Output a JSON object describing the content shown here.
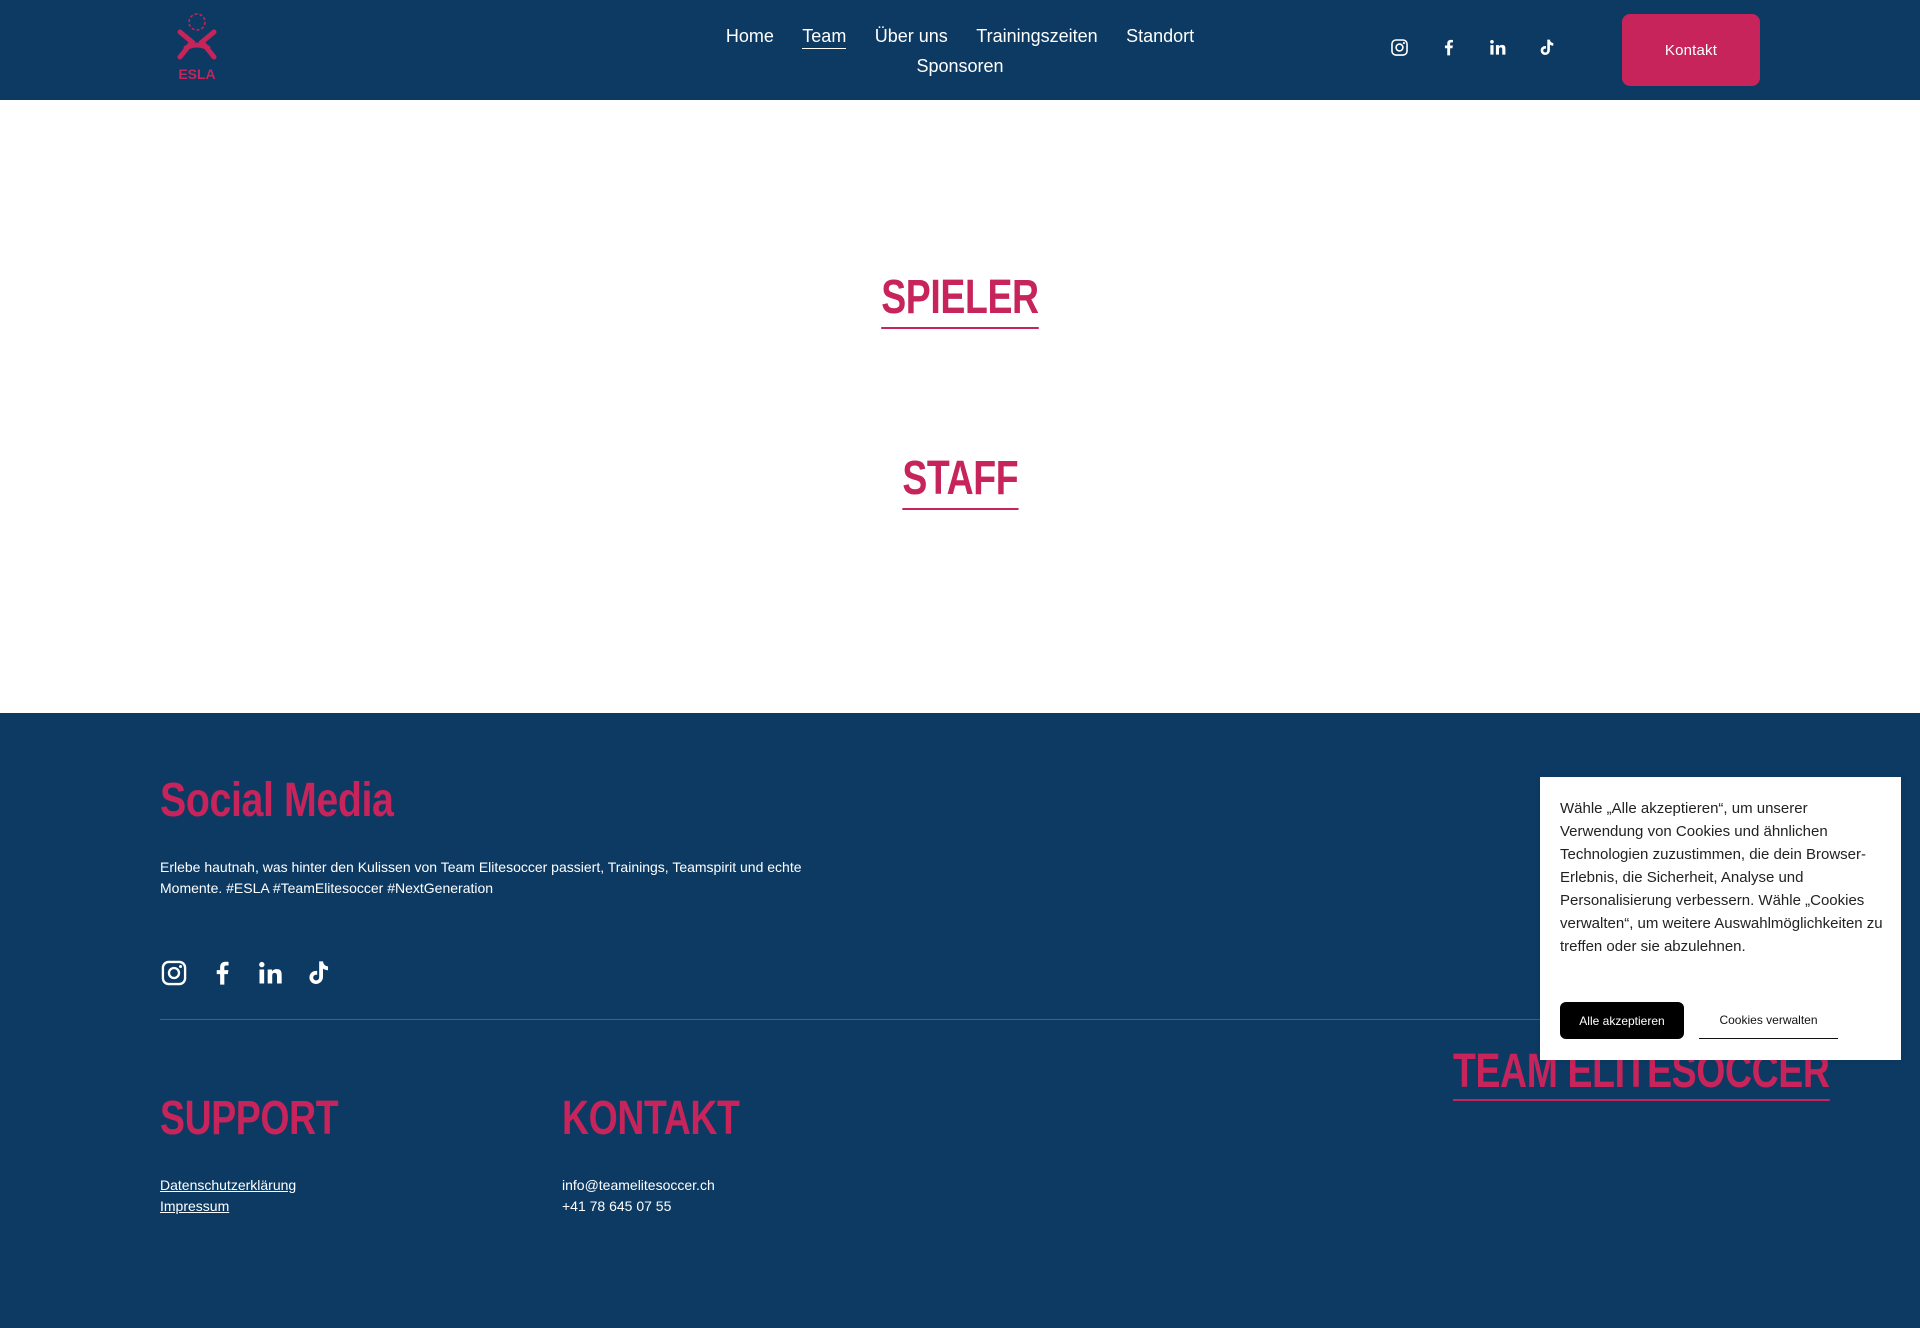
{
  "header": {
    "logo_text": "ESLA",
    "nav": [
      "Home",
      "Team",
      "Über uns",
      "Trainingszeiten",
      "Standort",
      "Sponsoren"
    ],
    "active_nav": "Team",
    "social_icons": [
      "instagram-icon",
      "facebook-icon",
      "linkedin-icon",
      "tiktok-icon"
    ],
    "contact_button": "Kontakt"
  },
  "main": {
    "sections": [
      "SPIELER",
      "STAFF"
    ]
  },
  "footer": {
    "social_title": "Social Media",
    "social_desc": "Erlebe hautnah, was hinter den Kulissen von Team Elitesoccer passiert, Trainings, Teamspirit und echte Momente. #ESLA #TeamElitesoccer #NextGeneration",
    "support_title": "SUPPORT",
    "support_links": [
      "Datenschutzerklärung",
      "Impressum"
    ],
    "contact_title": "KONTAKT",
    "contact_email": "info@teamelitesoccer.ch",
    "contact_phone": "+41 78 645 07 55",
    "team_title": "TEAM ELITESOCCER"
  },
  "cookie": {
    "text": "Wähle „Alle akzeptieren“, um unserer Verwendung von Cookies und ähnlichen Technologien zuzustimmen, die dein Browser-Erlebnis, die Sicherheit, Analyse und Personalisierung verbessern. Wähle „Cookies verwalten“, um weitere Auswahlmöglichkeiten zu treffen oder sie abzulehnen.",
    "accept": "Alle akzeptieren",
    "manage": "Cookies verwalten"
  },
  "colors": {
    "navy": "#0c3a63",
    "accent": "#c6245a"
  }
}
